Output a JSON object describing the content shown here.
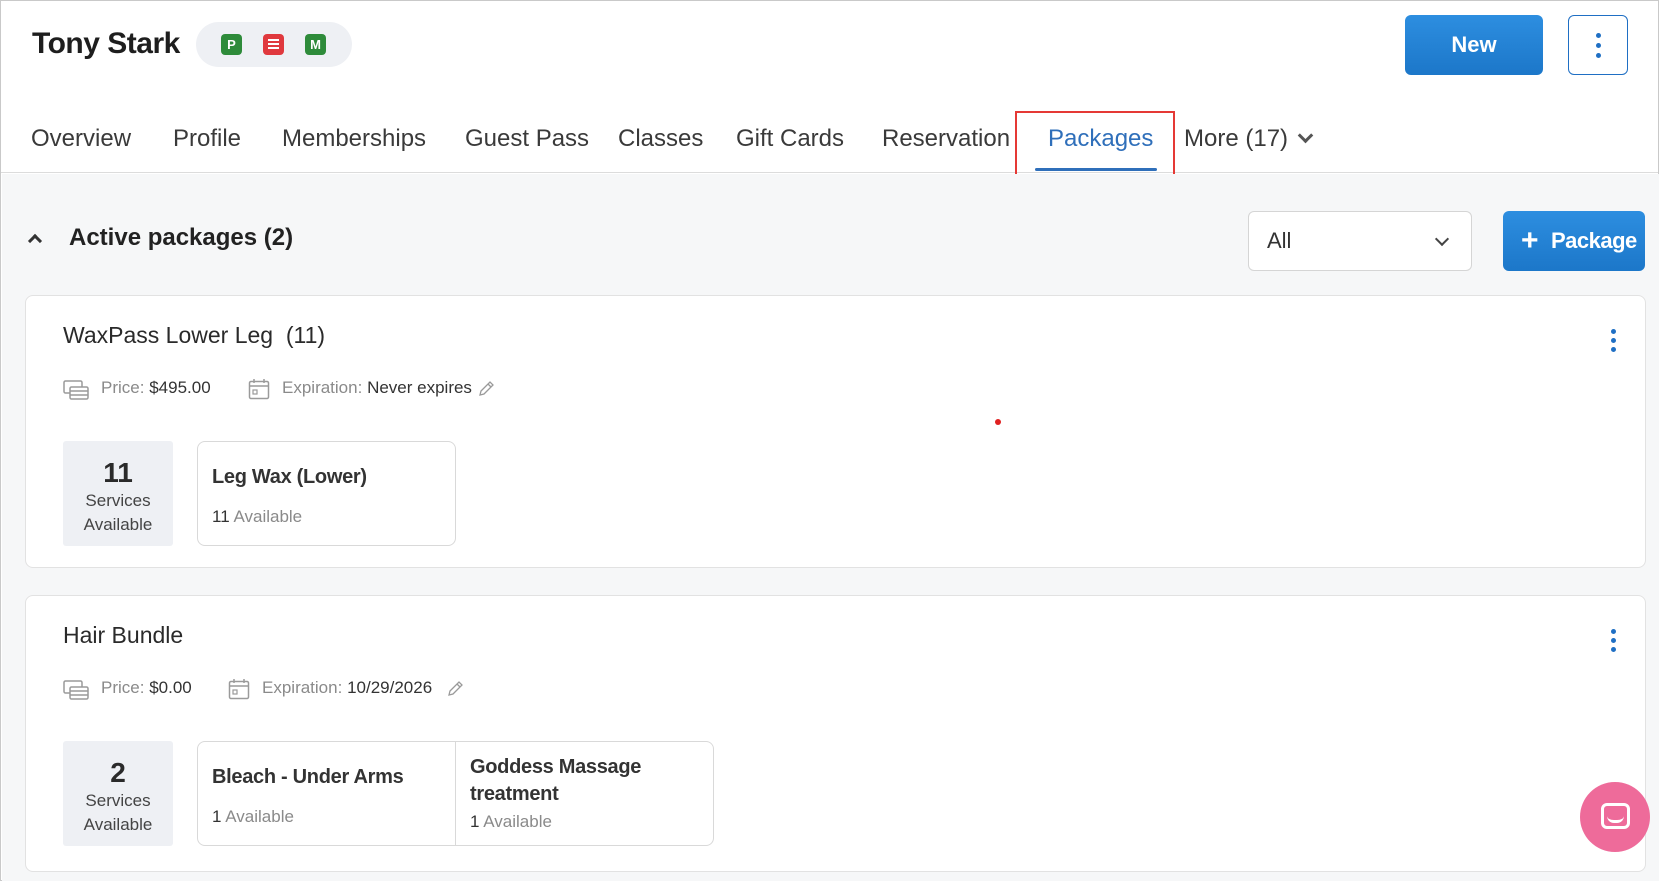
{
  "header": {
    "client_name": "Tony Stark",
    "badges": [
      "P",
      "chat-icon",
      "M"
    ],
    "new_button": "New"
  },
  "tabs": [
    {
      "label": "Overview"
    },
    {
      "label": "Profile"
    },
    {
      "label": "Memberships"
    },
    {
      "label": "Guest Pass"
    },
    {
      "label": "Classes"
    },
    {
      "label": "Gift Cards"
    },
    {
      "label": "Reservation"
    },
    {
      "label": "Packages",
      "active": true
    },
    {
      "label": "More (17)"
    }
  ],
  "section": {
    "title": "Active packages (2)",
    "filter_value": "All",
    "add_button": "Package"
  },
  "packages": [
    {
      "title": "WaxPass Lower Leg  (11)",
      "price_label": "Price:",
      "price": "$495.00",
      "expiration_label": "Expiration:",
      "expiration": "Never expires",
      "services_count": "11",
      "services_text_1": "Services",
      "services_text_2": "Available",
      "services": [
        {
          "name": "Leg Wax (Lower)",
          "available": "11",
          "available_label": "Available"
        }
      ]
    },
    {
      "title": "Hair Bundle",
      "price_label": "Price:",
      "price": "$0.00",
      "expiration_label": "Expiration:",
      "expiration": "10/29/2026",
      "services_count": "2",
      "services_text_1": "Services",
      "services_text_2": "Available",
      "services": [
        {
          "name": "Bleach - Under Arms",
          "available": "1",
          "available_label": "Available"
        },
        {
          "name": "Goddess Massage treatment",
          "available": "1",
          "available_label": "Available"
        }
      ]
    }
  ],
  "colors": {
    "accent": "#1f6fc4",
    "active_tab": "#2f6fba",
    "highlight": "#e53935",
    "chat_fab": "#ee6b9a",
    "badge_green": "#2e8b3a",
    "badge_red": "#e0393e"
  }
}
